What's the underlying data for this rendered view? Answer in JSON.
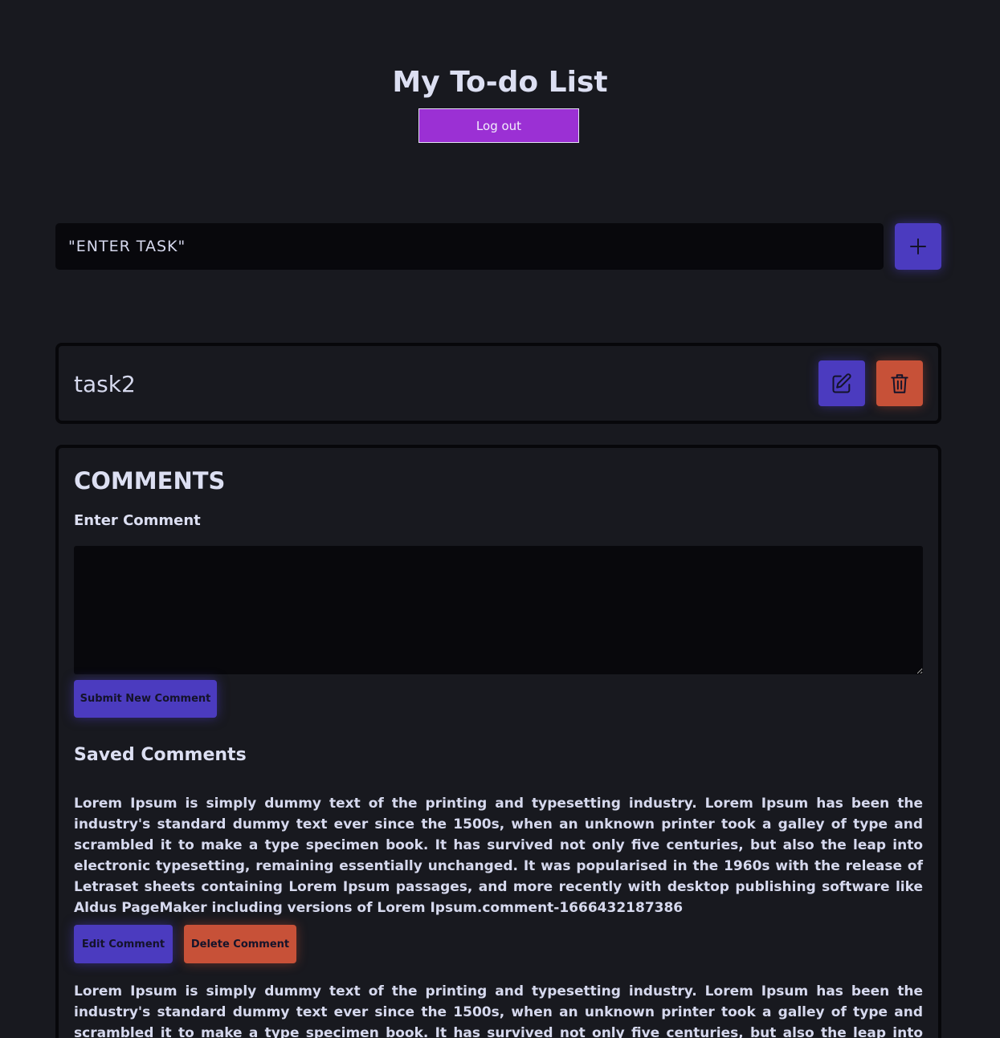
{
  "header": {
    "title": "My To-do List",
    "logout_label": "Log out"
  },
  "task_entry": {
    "value": "\"ENTER TASK\"",
    "add_icon": "plus-icon"
  },
  "tasks": [
    {
      "name": "task2",
      "edit_icon": "pencil-square-icon",
      "delete_icon": "trash-icon"
    }
  ],
  "comments": {
    "heading": "COMMENTS",
    "enter_label": "Enter Comment",
    "textarea_value": "",
    "submit_label": "Submit New Comment",
    "saved_heading": "Saved Comments",
    "items": [
      {
        "text": "Lorem Ipsum is simply dummy text of the printing and typesetting industry. Lorem Ipsum has been the industry's standard dummy text ever since the 1500s, when an unknown printer took a galley of type and scrambled it to make a type specimen book. It has survived not only five centuries, but also the leap into electronic typesetting, remaining essentially unchanged. It was popularised in the 1960s with the release of Letraset sheets containing Lorem Ipsum passages, and more recently with desktop publishing software like Aldus PageMaker including versions of Lorem Ipsum.comment-1666432187386",
        "edit_label": "Edit Comment",
        "delete_label": "Delete Comment"
      },
      {
        "text": "Lorem Ipsum is simply dummy text of the printing and typesetting industry. Lorem Ipsum has been the industry's standard dummy text ever since the 1500s, when an unknown printer took a galley of type and scrambled it to make a type specimen book. It has survived not only five centuries, but also the leap into electronic typesetting,"
      }
    ]
  },
  "colors": {
    "background": "#18191f",
    "primary": "#4b3bbf",
    "danger": "#c75138",
    "logout": "#9b30d4",
    "input_bg": "#08080c"
  }
}
